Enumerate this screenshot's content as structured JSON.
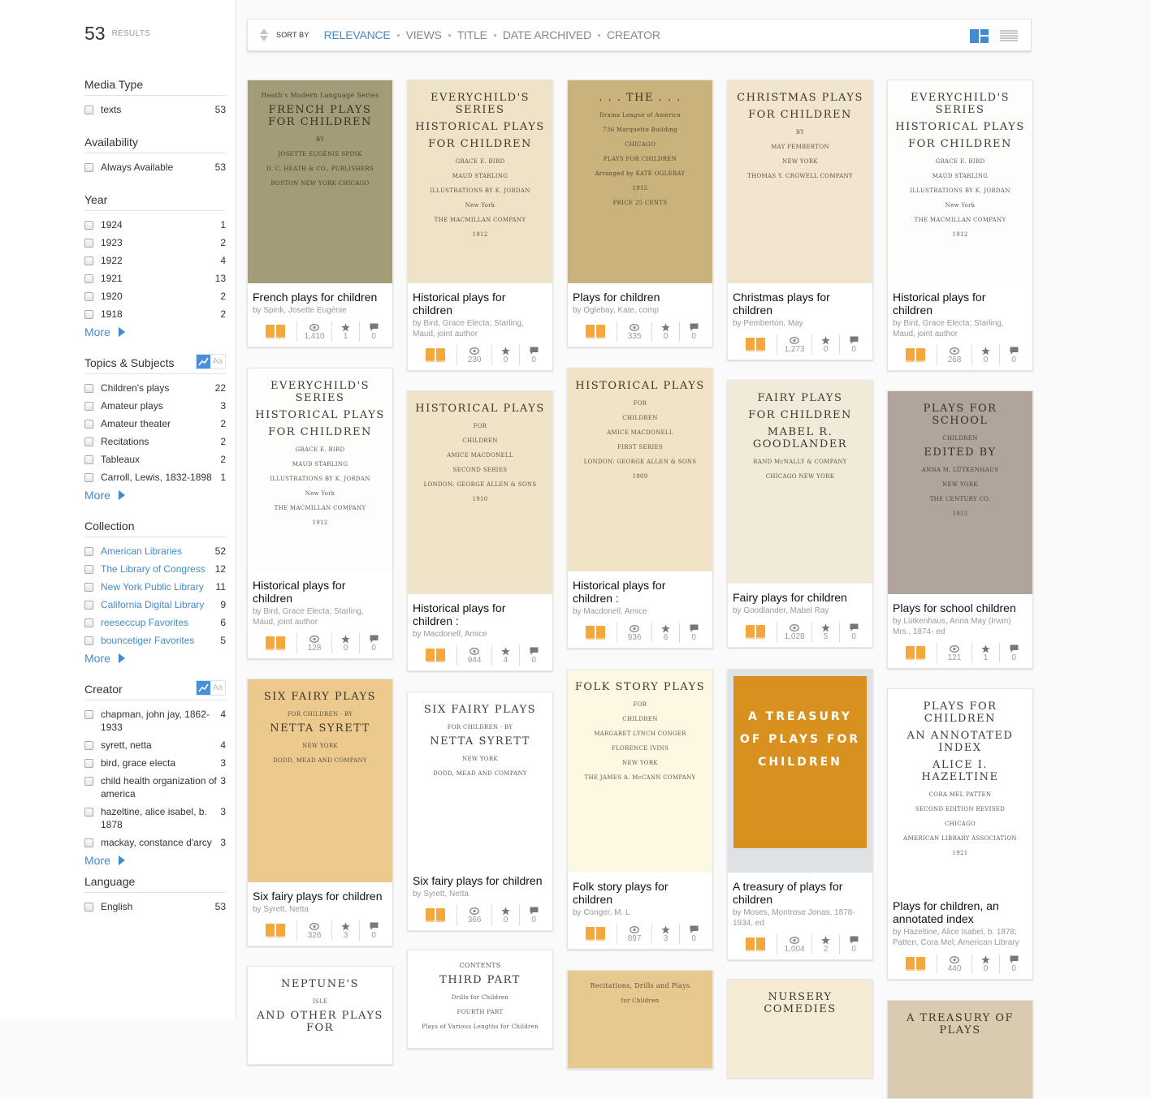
{
  "results": {
    "count": "53",
    "label": "RESULTS"
  },
  "facets": {
    "media_type": {
      "title": "Media Type",
      "items": [
        {
          "label": "texts",
          "count": "53"
        }
      ]
    },
    "availability": {
      "title": "Availability",
      "items": [
        {
          "label": "Always Available",
          "count": "53"
        }
      ]
    },
    "year": {
      "title": "Year",
      "items": [
        {
          "label": "1924",
          "count": "1"
        },
        {
          "label": "1923",
          "count": "2"
        },
        {
          "label": "1922",
          "count": "4"
        },
        {
          "label": "1921",
          "count": "13"
        },
        {
          "label": "1920",
          "count": "2"
        },
        {
          "label": "1918",
          "count": "2"
        }
      ],
      "more": "More"
    },
    "topics": {
      "title": "Topics & Subjects",
      "toggle_text": "Aa",
      "items": [
        {
          "label": "Children's plays",
          "count": "22"
        },
        {
          "label": "Amateur plays",
          "count": "3"
        },
        {
          "label": "Amateur theater",
          "count": "2"
        },
        {
          "label": "Recitations",
          "count": "2"
        },
        {
          "label": "Tableaux",
          "count": "2"
        },
        {
          "label": "Carroll, Lewis, 1832-1898",
          "count": "1"
        }
      ],
      "more": "More"
    },
    "collection": {
      "title": "Collection",
      "items": [
        {
          "label": "American Libraries",
          "count": "52"
        },
        {
          "label": "The Library of Congress",
          "count": "12"
        },
        {
          "label": "New York Public Library",
          "count": "11"
        },
        {
          "label": "California Digital Library",
          "count": "9"
        },
        {
          "label": "reeseccup Favorites",
          "count": "6"
        },
        {
          "label": "bouncetiger Favorites",
          "count": "5"
        }
      ],
      "more": "More"
    },
    "creator": {
      "title": "Creator",
      "toggle_text": "Aa",
      "items": [
        {
          "label": "chapman, john jay, 1862-1933",
          "count": "4"
        },
        {
          "label": "syrett, netta",
          "count": "4"
        },
        {
          "label": "bird, grace electa",
          "count": "3"
        },
        {
          "label": "child health organization of america",
          "count": "3"
        },
        {
          "label": "hazeltine, alice isabel, b. 1878",
          "count": "3"
        },
        {
          "label": "mackay, constance d'arcy",
          "count": "3"
        }
      ],
      "more": "More"
    },
    "language": {
      "title": "Language",
      "items": [
        {
          "label": "English",
          "count": "53"
        }
      ]
    }
  },
  "sortbar": {
    "label": "SORT BY",
    "options": [
      "RELEVANCE",
      "VIEWS",
      "TITLE",
      "DATE ARCHIVED",
      "CREATOR"
    ],
    "active": "RELEVANCE",
    "accent_color": "#428bca"
  },
  "items": [
    {
      "title": "French plays for children",
      "author": "by Spink, Josette Eugénie",
      "views": "1,410",
      "favorites": "1",
      "reviews": "0",
      "cover": {
        "bg": "#a39c78",
        "lines": [
          "Heath's Modern Language Series",
          "FRENCH PLAYS FOR CHILDREN",
          "BY",
          "JOSETTE EUGÉNIE SPINK",
          "D. C. HEATH & CO., PUBLISHERS",
          "BOSTON   NEW YORK   CHICAGO"
        ]
      }
    },
    {
      "title": "Historical plays for children",
      "author": "by Bird, Grace Electa; Starling, Maud, joint author",
      "views": "230",
      "favorites": "0",
      "reviews": "0",
      "cover": {
        "bg": "#efe3c7",
        "lines": [
          "EVERYCHILD'S SERIES",
          "HISTORICAL PLAYS",
          "FOR CHILDREN",
          "GRACE E. BIRD",
          "MAUD STARLING",
          "ILLUSTRATIONS BY K. JORDAN",
          "New York",
          "THE MACMILLAN COMPANY",
          "1912"
        ]
      }
    },
    {
      "title": "Plays for children",
      "author": "by Oglebay, Kate, comp",
      "views": "335",
      "favorites": "0",
      "reviews": "0",
      "cover": {
        "bg": "#c9b27c",
        "lines": [
          ". . . THE . . .",
          "Drama League of America",
          "736 Marquette Building",
          "CHICAGO",
          "PLAYS FOR CHILDREN",
          "Arranged by KATE OGLEBAY",
          "1915",
          "PRICE 25 CENTS"
        ]
      }
    },
    {
      "title": "Christmas plays for children",
      "author": "by Pemberton, May",
      "views": "1,273",
      "favorites": "0",
      "reviews": "0",
      "cover": {
        "bg": "#f1e6cd",
        "lines": [
          "CHRISTMAS PLAYS",
          "FOR CHILDREN",
          "BY",
          "MAY PEMBERTON",
          "NEW YORK",
          "THOMAS Y. CROWELL COMPANY"
        ]
      }
    },
    {
      "title": "Historical plays for children",
      "author": "by Bird, Grace Electa; Starling, Maud, joint author",
      "views": "268",
      "favorites": "0",
      "reviews": "0",
      "cover": {
        "bg": "#fdfdfb",
        "lines": [
          "EVERYCHILD'S SERIES",
          "HISTORICAL PLAYS",
          "FOR CHILDREN",
          "GRACE E. BIRD",
          "MAUD STARLING",
          "ILLUSTRATIONS BY K. JORDAN",
          "New York",
          "THE MACMILLAN COMPANY",
          "1912"
        ]
      }
    },
    {
      "title": "Historical plays for children",
      "author": "by Bird, Grace Electa; Starling, Maud, joint author",
      "views": "128",
      "favorites": "0",
      "reviews": "0",
      "cover": {
        "bg": "#fdfdfb",
        "lines": [
          "EVERYCHILD'S SERIES",
          "HISTORICAL PLAYS",
          "FOR CHILDREN",
          "GRACE E. BIRD",
          "MAUD STARLING",
          "ILLUSTRATIONS BY K. JORDAN",
          "New York",
          "THE MACMILLAN COMPANY",
          "1912"
        ]
      }
    },
    {
      "title": "Historical plays for children :",
      "author": "by Macdonell, Amice",
      "views": "944",
      "favorites": "4",
      "reviews": "0",
      "cover": {
        "bg": "#f0e4c8",
        "lines": [
          "HISTORICAL PLAYS",
          "FOR",
          "CHILDREN",
          "AMICE MACDONELL",
          "SECOND SERIES",
          "LONDON: GEORGE ALLEN & SONS",
          "1910"
        ]
      }
    },
    {
      "title": "Historical plays for children :",
      "author": "by Macdonell, Amice",
      "views": "936",
      "favorites": "6",
      "reviews": "0",
      "cover": {
        "bg": "#f1e4c6",
        "lines": [
          "HISTORICAL PLAYS",
          "FOR",
          "CHILDREN",
          "AMICE MACDONELL",
          "FIRST SERIES",
          "LONDON: GEORGE ALLEN & SONS",
          "1909"
        ]
      }
    },
    {
      "title": "Fairy plays for children",
      "author": "by Goodlander, Mabel Ray",
      "views": "1,028",
      "favorites": "5",
      "reviews": "0",
      "cover": {
        "bg": "#f2ead9",
        "lines": [
          "FAIRY PLAYS",
          "FOR CHILDREN",
          "MABEL R. GOODLANDER",
          "RAND McNALLY & COMPANY",
          "CHICAGO   NEW YORK"
        ]
      }
    },
    {
      "title": "Plays for school children",
      "author": "by Lütkenhaus, Anna May (Irwin) Mrs., 1874- ed",
      "views": "121",
      "favorites": "1",
      "reviews": "0",
      "cover": {
        "bg": "#b1a49d",
        "lines": [
          "PLAYS FOR SCHOOL",
          "CHILDREN",
          "EDITED BY",
          "ANNA M. LÜTKENHAUS",
          "NEW YORK",
          "THE CENTURY CO.",
          "1915"
        ]
      }
    },
    {
      "title": "Six fairy plays for children",
      "author": "by Syrett, Netta",
      "views": "326",
      "favorites": "3",
      "reviews": "0",
      "cover": {
        "bg": "#ecca8e",
        "lines": [
          "SIX FAIRY PLAYS",
          "FOR CHILDREN · BY",
          "NETTA SYRETT",
          "NEW YORK",
          "DODD, MEAD AND COMPANY"
        ]
      }
    },
    {
      "title": "Six fairy plays for children",
      "author": "by Syrett, Netta",
      "views": "366",
      "favorites": "0",
      "reviews": "0",
      "cover": {
        "bg": "#ffffff",
        "lines": [
          "SIX FAIRY PLAYS",
          "FOR CHILDREN · BY",
          "NETTA SYRETT",
          "NEW YORK",
          "DODD, MEAD AND COMPANY"
        ]
      }
    },
    {
      "title": "Folk story plays for children",
      "author": "by Conger, M. L",
      "views": "897",
      "favorites": "3",
      "reviews": "0",
      "cover": {
        "bg": "#fdf8e2",
        "lines": [
          "FOLK STORY PLAYS",
          "FOR",
          "CHILDREN",
          "MARGARET LYNCH CONGER",
          "FLORENCE IVINS",
          "NEW YORK",
          "THE JAMES A. McCANN COMPANY"
        ]
      }
    },
    {
      "title": "A treasury of plays for children",
      "author": "by Moses, Montrose Jonas, 1878-1934, ed",
      "views": "1,004",
      "favorites": "2",
      "reviews": "0",
      "cover": {
        "bg": "#dfe2e4",
        "lines": [
          "A TREASURY",
          "OF PLAYS FOR",
          "CHILDREN"
        ]
      }
    },
    {
      "title": "Plays for children, an annotated index",
      "author": "by Hazeltine, Alice Isabel, b. 1878; Patten, Cora Mel; American Library",
      "views": "440",
      "favorites": "0",
      "reviews": "0",
      "cover": {
        "bg": "#ffffff",
        "lines": [
          "PLAYS FOR CHILDREN",
          "AN ANNOTATED INDEX",
          "ALICE I. HAZELTINE",
          "CORA MEL PATTEN",
          "SECOND EDITION REVISED",
          "CHICAGO",
          "AMERICAN LIBRARY ASSOCIATION",
          "1921"
        ]
      }
    }
  ],
  "partial_items": [
    {
      "cover": {
        "bg": "#ffffff",
        "lines": [
          "NEPTUNE'S",
          "ISLE",
          "AND OTHER PLAYS FOR"
        ]
      }
    },
    {
      "cover": {
        "bg": "#ffffff",
        "lines": [
          "CONTENTS",
          "THIRD PART",
          "Drills for Children",
          "FOURTH PART",
          "Plays of Various Lengths for Children"
        ]
      }
    },
    {
      "cover": {
        "bg": "#e7c98f",
        "lines": [
          "Recitations, Drills and Plays",
          "for Children"
        ]
      }
    },
    {
      "cover": {
        "bg": "#f6ecd5",
        "lines": [
          "NURSERY COMEDIES"
        ]
      }
    },
    {
      "cover": {
        "bg": "#d9cbb0",
        "lines": [
          "A TREASURY OF PLAYS"
        ]
      }
    }
  ]
}
